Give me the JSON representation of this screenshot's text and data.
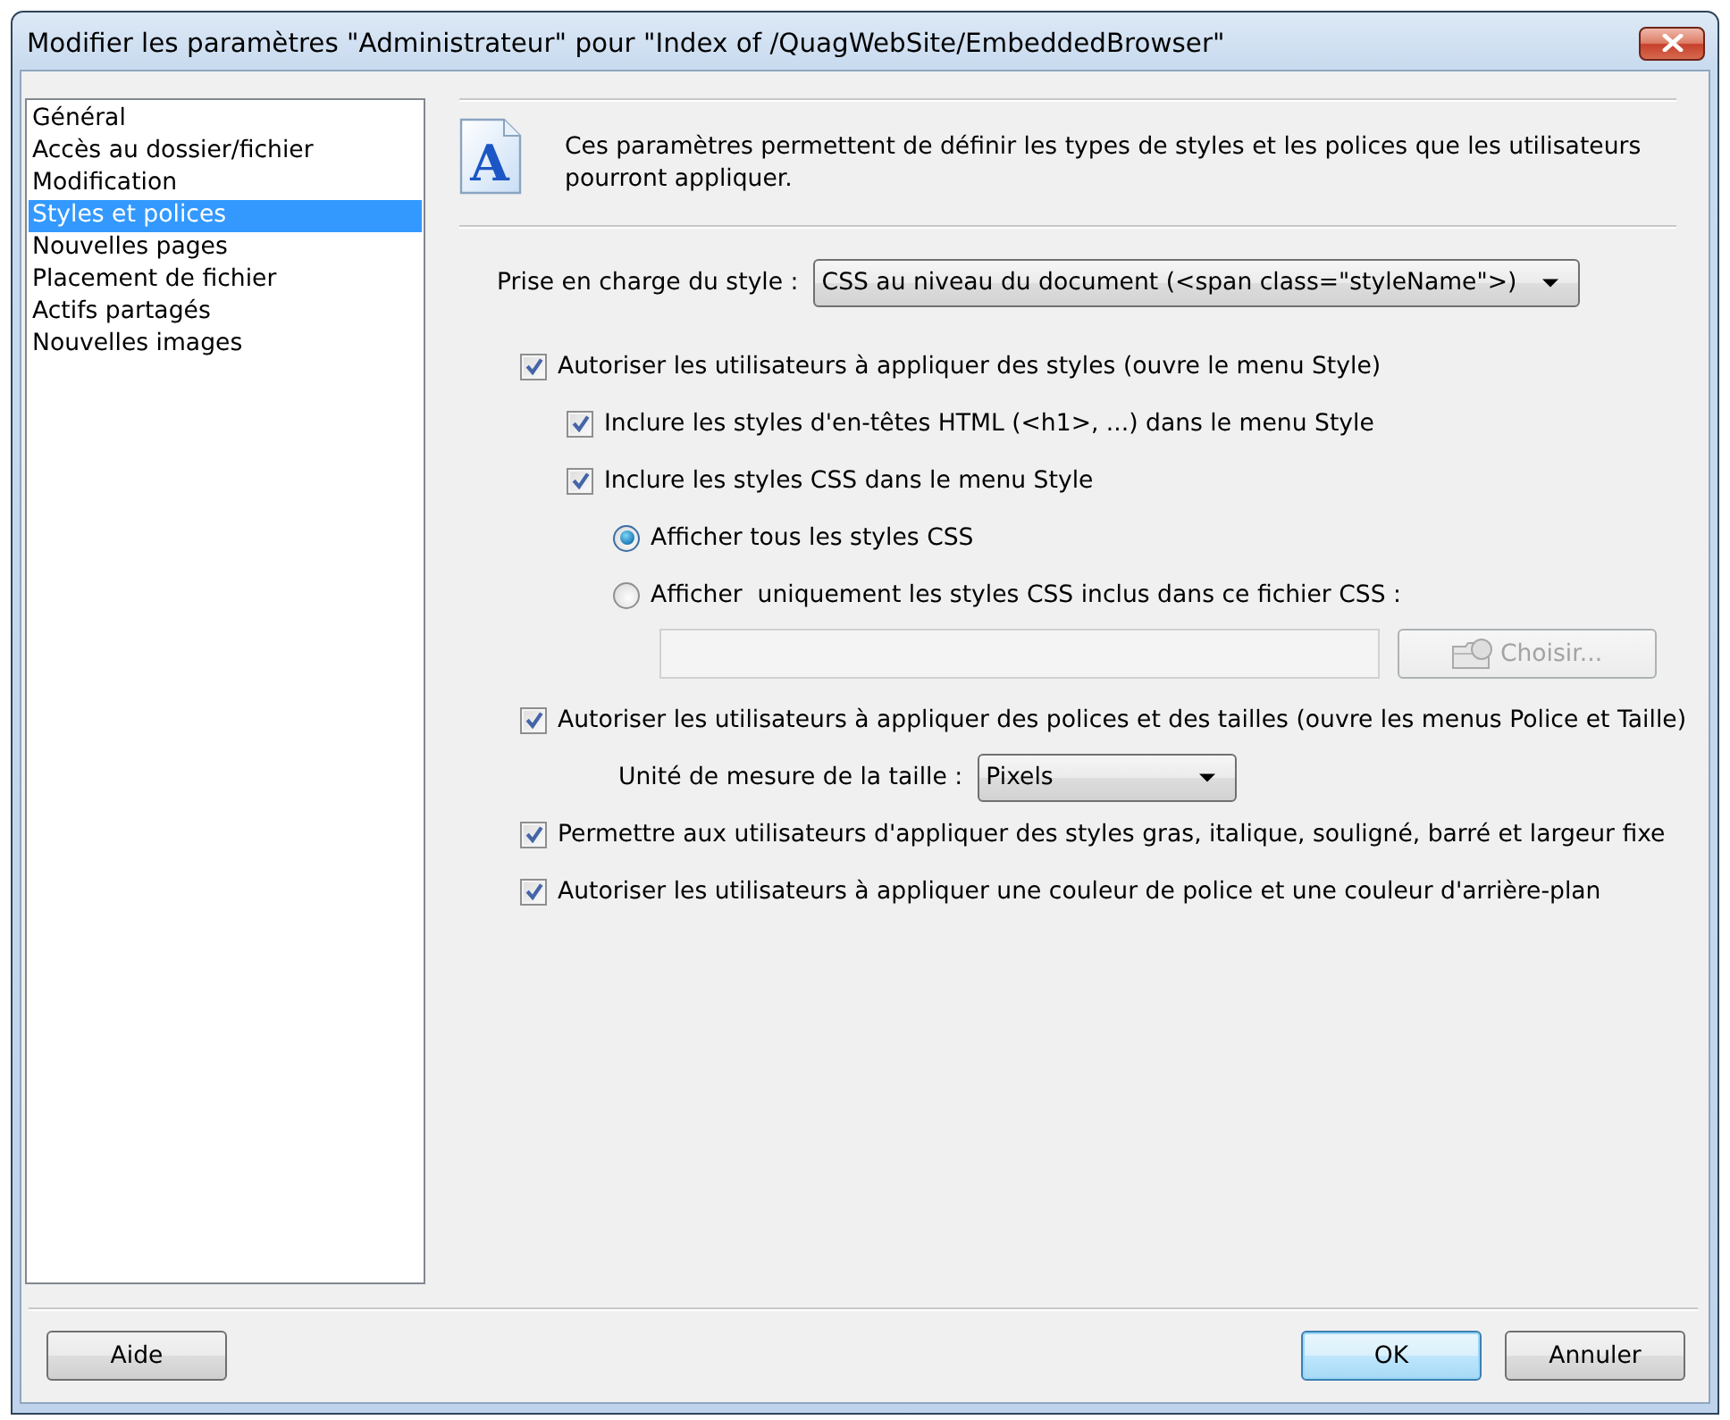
{
  "window": {
    "title": "Modifier les paramètres \"Administrateur\" pour \"Index of /QuagWebSite/EmbeddedBrowser\""
  },
  "sidebar": {
    "items": [
      {
        "label": "Général",
        "selected": false
      },
      {
        "label": "Accès au dossier/fichier",
        "selected": false
      },
      {
        "label": "Modification",
        "selected": false
      },
      {
        "label": "Styles et polices",
        "selected": true
      },
      {
        "label": "Nouvelles pages",
        "selected": false
      },
      {
        "label": "Placement de fichier",
        "selected": false
      },
      {
        "label": "Actifs partagés",
        "selected": false
      },
      {
        "label": "Nouvelles images",
        "selected": false
      }
    ]
  },
  "header": {
    "icon_letter": "A",
    "description": "Ces paramètres permettent de définir les types de styles et les polices que les utilisateurs pourront appliquer."
  },
  "style_support": {
    "label": "Prise en charge du style :",
    "value": "CSS au niveau du document (<span class=\"styleName\">)"
  },
  "options": [
    {
      "kind": "checkbox",
      "label": "Autoriser les utilisateurs à appliquer des styles (ouvre le menu Style)",
      "checked": true,
      "children": [
        {
          "kind": "checkbox",
          "label": "Inclure les styles d'en-têtes HTML (<h1>, ...) dans le menu Style",
          "checked": true
        },
        {
          "kind": "checkbox",
          "label": "Inclure les styles CSS dans le menu Style",
          "checked": true,
          "children": [
            {
              "kind": "radio",
              "label": "Afficher tous les styles CSS",
              "selected": true
            },
            {
              "kind": "radio",
              "label": "Afficher  uniquement les styles CSS inclus dans ce fichier CSS :",
              "selected": false,
              "children": [
                {
                  "kind": "file_field",
                  "button": "Choisir...",
                  "disabled": true
                }
              ]
            }
          ]
        }
      ]
    },
    {
      "kind": "checkbox",
      "label": "Autoriser les utilisateurs à appliquer des polices et des tailles (ouvre les menus Police et Taille)",
      "checked": true,
      "children": [
        {
          "kind": "select",
          "label": "Unité de mesure de la taille :",
          "value": "Pixels"
        }
      ]
    },
    {
      "kind": "checkbox",
      "label": "Permettre aux utilisateurs d'appliquer des styles gras, italique, souligné, barré et largeur fixe",
      "checked": true
    },
    {
      "kind": "checkbox",
      "label": "Autoriser les utilisateurs à appliquer une couleur de police et une couleur d'arrière-plan",
      "checked": true
    }
  ],
  "footer": {
    "help_button": "Aide",
    "buttons": [
      {
        "label": "OK",
        "default": true
      },
      {
        "label": "Annuler",
        "default": false
      }
    ]
  }
}
